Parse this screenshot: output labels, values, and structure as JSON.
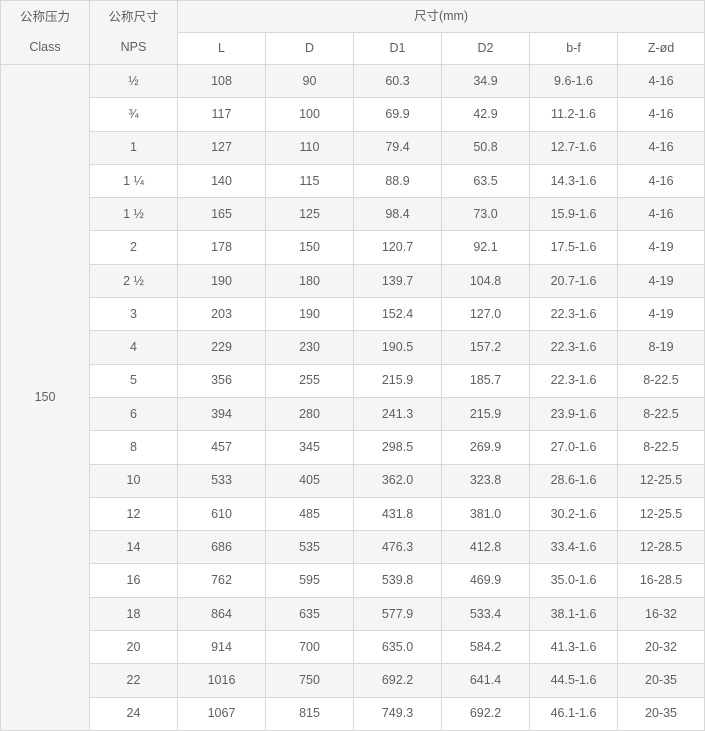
{
  "table": {
    "header": {
      "class_col": {
        "cn": "公称压力",
        "en": "Class"
      },
      "nps_col": {
        "cn": "公称尺寸",
        "en": "NPS"
      },
      "dim_group": "尺寸(mm)",
      "dim_columns": [
        "L",
        "D",
        "D1",
        "D2",
        "b-f",
        "Z-ød"
      ]
    },
    "class_value": "150",
    "rows": [
      {
        "nps": "½",
        "L": "108",
        "D": "90",
        "D1": "60.3",
        "D2": "34.9",
        "bf": "9.6-1.6",
        "zd": "4-16"
      },
      {
        "nps": "¾",
        "L": "117",
        "D": "100",
        "D1": "69.9",
        "D2": "42.9",
        "bf": "11.2-1.6",
        "zd": "4-16"
      },
      {
        "nps": "1",
        "L": "127",
        "D": "110",
        "D1": "79.4",
        "D2": "50.8",
        "bf": "12.7-1.6",
        "zd": "4-16"
      },
      {
        "nps": "1 ¼",
        "L": "140",
        "D": "115",
        "D1": "88.9",
        "D2": "63.5",
        "bf": "14.3-1.6",
        "zd": "4-16"
      },
      {
        "nps": "1 ½",
        "L": "165",
        "D": "125",
        "D1": "98.4",
        "D2": "73.0",
        "bf": "15.9-1.6",
        "zd": "4-16"
      },
      {
        "nps": "2",
        "L": "178",
        "D": "150",
        "D1": "120.7",
        "D2": "92.1",
        "bf": "17.5-1.6",
        "zd": "4-19"
      },
      {
        "nps": "2 ½",
        "L": "190",
        "D": "180",
        "D1": "139.7",
        "D2": "104.8",
        "bf": "20.7-1.6",
        "zd": "4-19"
      },
      {
        "nps": "3",
        "L": "203",
        "D": "190",
        "D1": "152.4",
        "D2": "127.0",
        "bf": "22.3-1.6",
        "zd": "4-19"
      },
      {
        "nps": "4",
        "L": "229",
        "D": "230",
        "D1": "190.5",
        "D2": "157.2",
        "bf": "22.3-1.6",
        "zd": "8-19"
      },
      {
        "nps": "5",
        "L": "356",
        "D": "255",
        "D1": "215.9",
        "D2": "185.7",
        "bf": "22.3-1.6",
        "zd": "8-22.5"
      },
      {
        "nps": "6",
        "L": "394",
        "D": "280",
        "D1": "241.3",
        "D2": "215.9",
        "bf": "23.9-1.6",
        "zd": "8-22.5"
      },
      {
        "nps": "8",
        "L": "457",
        "D": "345",
        "D1": "298.5",
        "D2": "269.9",
        "bf": "27.0-1.6",
        "zd": "8-22.5"
      },
      {
        "nps": "10",
        "L": "533",
        "D": "405",
        "D1": "362.0",
        "D2": "323.8",
        "bf": "28.6-1.6",
        "zd": "12-25.5"
      },
      {
        "nps": "12",
        "L": "610",
        "D": "485",
        "D1": "431.8",
        "D2": "381.0",
        "bf": "30.2-1.6",
        "zd": "12-25.5"
      },
      {
        "nps": "14",
        "L": "686",
        "D": "535",
        "D1": "476.3",
        "D2": "412.8",
        "bf": "33.4-1.6",
        "zd": "12-28.5"
      },
      {
        "nps": "16",
        "L": "762",
        "D": "595",
        "D1": "539.8",
        "D2": "469.9",
        "bf": "35.0-1.6",
        "zd": "16-28.5"
      },
      {
        "nps": "18",
        "L": "864",
        "D": "635",
        "D1": "577.9",
        "D2": "533.4",
        "bf": "38.1-1.6",
        "zd": "16-32"
      },
      {
        "nps": "20",
        "L": "914",
        "D": "700",
        "D1": "635.0",
        "D2": "584.2",
        "bf": "41.3-1.6",
        "zd": "20-32"
      },
      {
        "nps": "22",
        "L": "1016",
        "D": "750",
        "D1": "692.2",
        "D2": "641.4",
        "bf": "44.5-1.6",
        "zd": "20-35"
      },
      {
        "nps": "24",
        "L": "1067",
        "D": "815",
        "D1": "749.3",
        "D2": "692.2",
        "bf": "46.1-1.6",
        "zd": "20-35"
      }
    ]
  },
  "colors": {
    "header_bg": "#f5f5f5",
    "row_alt_bg": "#f5f5f5",
    "row_bg": "#ffffff",
    "border": "#d8d8d8",
    "text": "#5f5f5f"
  }
}
